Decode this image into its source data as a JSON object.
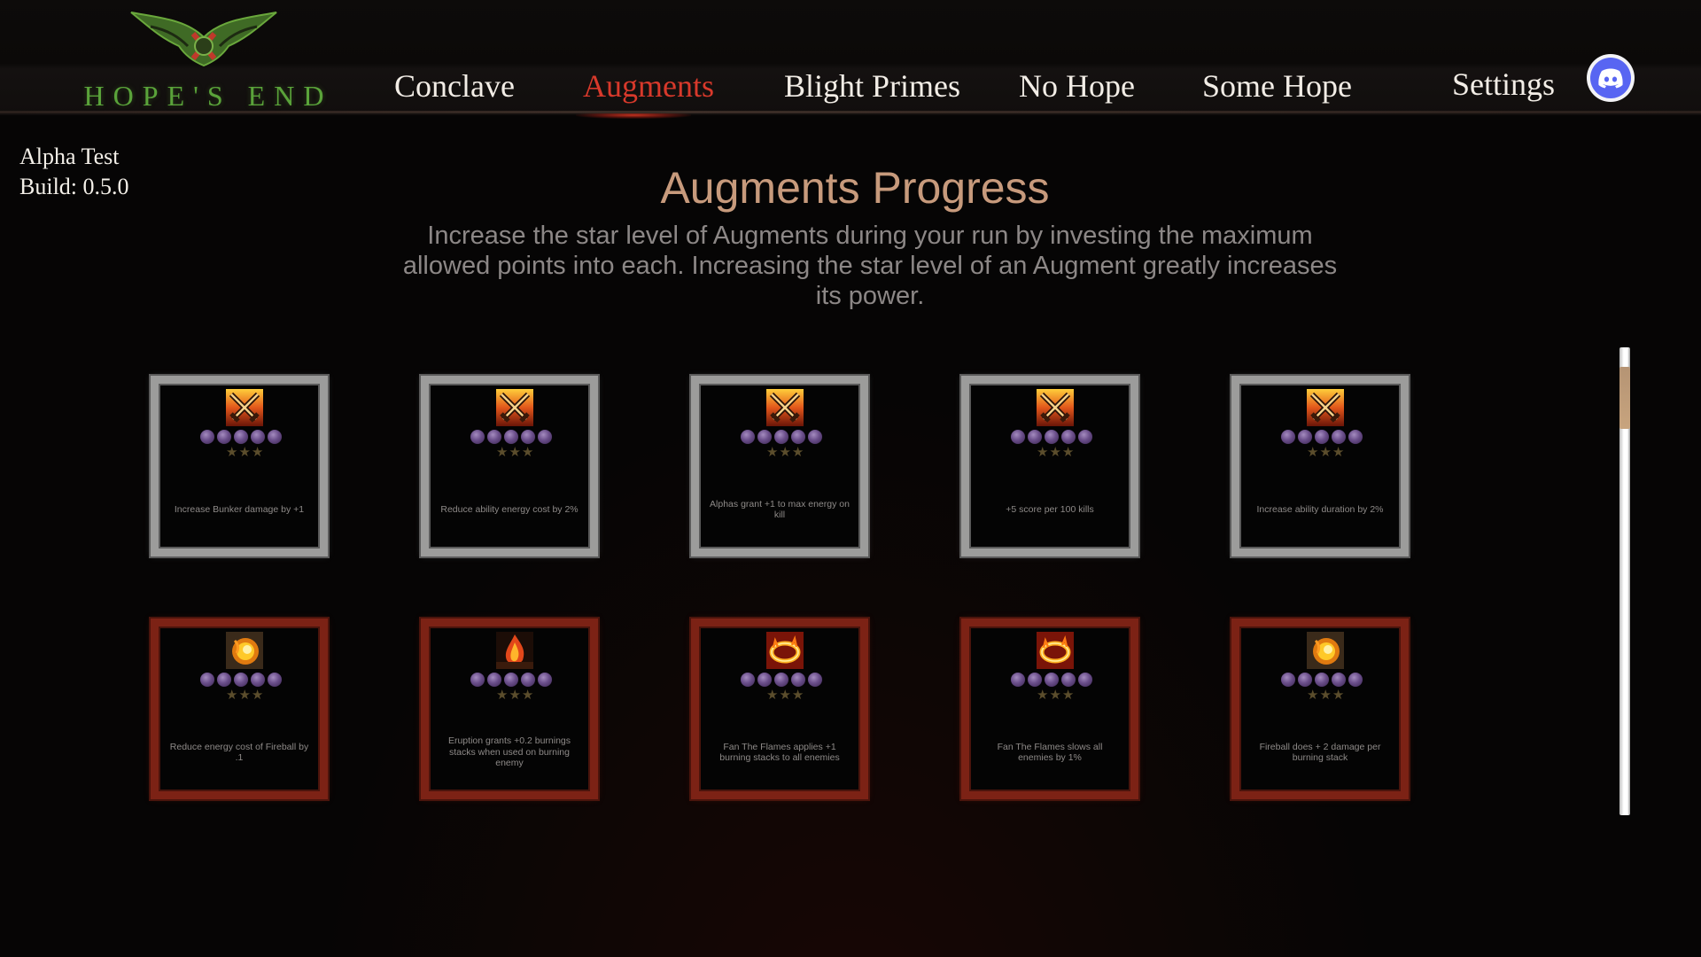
{
  "logo": {
    "text": "HOPE'S END"
  },
  "nav": {
    "items": [
      {
        "label": "Conclave"
      },
      {
        "label": "Augments"
      },
      {
        "label": "Blight Primes"
      },
      {
        "label": "No Hope"
      },
      {
        "label": "Some Hope"
      },
      {
        "label": "Settings"
      }
    ],
    "active": "Augments",
    "discord_icon": "discord-icon"
  },
  "version": {
    "line1": "Alpha Test",
    "line2": "Build: 0.5.0"
  },
  "heading": {
    "title": "Augments Progress",
    "description": "Increase the star level of Augments during your run by investing the maximum allowed points into each. Increasing the star level of an Augment greatly increases its power."
  },
  "colors": {
    "accent_red": "#d8392b",
    "logo_green": "#5aa33a",
    "title_tan": "#c79a7c",
    "grey_frame": "#9c9c9b",
    "red_frame": "#7c2215"
  },
  "augments": [
    {
      "text": "Increase Bunker damage by +1",
      "icon": "crossed-swords-icon",
      "frame": "grey",
      "points": 5,
      "stars": 3
    },
    {
      "text": "Reduce ability energy cost by 2%",
      "icon": "crossed-swords-icon",
      "frame": "grey",
      "points": 5,
      "stars": 3
    },
    {
      "text": "Alphas grant +1 to max energy on kill",
      "icon": "crossed-swords-icon",
      "frame": "grey",
      "points": 5,
      "stars": 3
    },
    {
      "text": "+5 score per 100 kills",
      "icon": "crossed-swords-icon",
      "frame": "grey",
      "points": 5,
      "stars": 3
    },
    {
      "text": "Increase ability duration by 2%",
      "icon": "crossed-swords-icon",
      "frame": "grey",
      "points": 5,
      "stars": 3
    },
    {
      "text": "Reduce energy cost of Fireball by .1",
      "icon": "fireball-icon",
      "frame": "red",
      "points": 5,
      "stars": 3
    },
    {
      "text": "Eruption grants +0.2 burnings stacks when used on burning enemy",
      "icon": "eruption-icon",
      "frame": "red",
      "points": 5,
      "stars": 3
    },
    {
      "text": "Fan The Flames applies +1 burning stacks to all enemies",
      "icon": "fire-ring-icon",
      "frame": "red",
      "points": 5,
      "stars": 3
    },
    {
      "text": "Fan The Flames slows all enemies by 1%",
      "icon": "fire-ring-icon",
      "frame": "red",
      "points": 5,
      "stars": 3
    },
    {
      "text": "Fireball does + 2 damage per burning stack",
      "icon": "fireball-icon",
      "frame": "red",
      "points": 5,
      "stars": 3
    }
  ]
}
